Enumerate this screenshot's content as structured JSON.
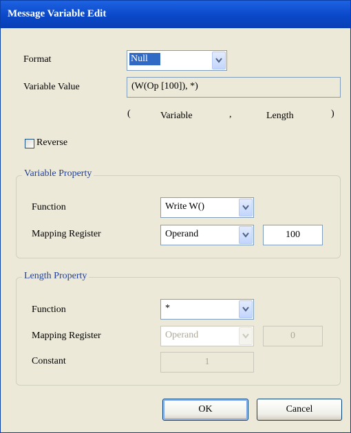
{
  "window": {
    "title": "Message Variable Edit"
  },
  "format": {
    "label": "Format",
    "value": "Null"
  },
  "variable_value": {
    "label": "Variable Value",
    "value": "(W(Op [100]), *)",
    "hint": {
      "open": "(",
      "variable": "Variable",
      "comma": ",",
      "length": "Length",
      "close": ")"
    }
  },
  "reverse": {
    "label": "Reverse",
    "checked": false
  },
  "variable_property": {
    "title": "Variable Property",
    "function_label": "Function",
    "function_value": "Write W()",
    "mapping_label": "Mapping Register",
    "mapping_value": "Operand",
    "mapping_number": "100"
  },
  "length_property": {
    "title": "Length Property",
    "function_label": "Function",
    "function_value": "*",
    "mapping_label": "Mapping Register",
    "mapping_value": "Operand",
    "mapping_number": "0",
    "constant_label": "Constant",
    "constant_value": "1"
  },
  "buttons": {
    "ok": "OK",
    "cancel": "Cancel"
  }
}
